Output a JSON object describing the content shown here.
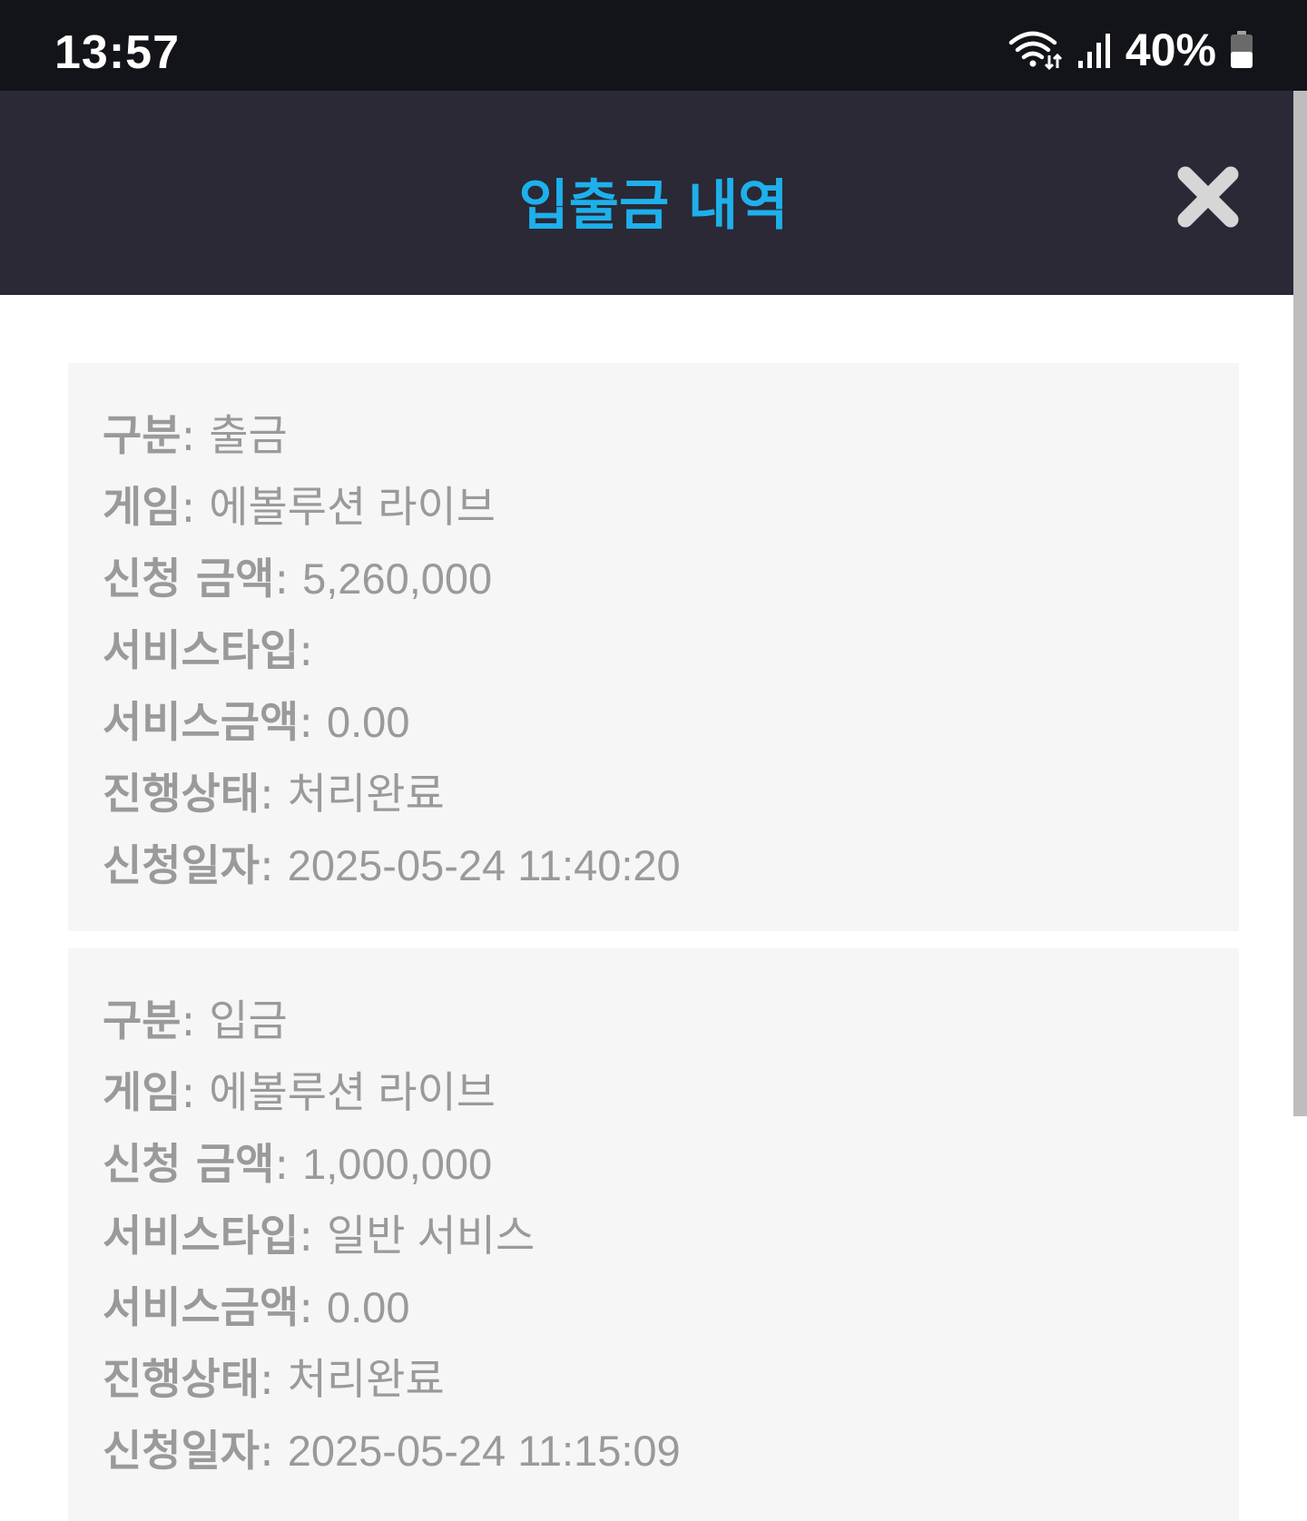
{
  "status_bar": {
    "time": "13:57",
    "battery": "40%"
  },
  "header": {
    "title": "입출금 내역"
  },
  "labels": {
    "type": "구분",
    "game": "게임",
    "amount": "신청 금액",
    "service_type": "서비스타입",
    "service_amount": "서비스금액",
    "status": "진행상태",
    "date": "신청일자"
  },
  "records": [
    {
      "type": "출금",
      "game": "에볼루션 라이브",
      "amount": "5,260,000",
      "service_type": "",
      "service_amount": "0.00",
      "status": "처리완료",
      "date": "2025-05-24 11:40:20"
    },
    {
      "type": "입금",
      "game": "에볼루션 라이브",
      "amount": "1,000,000",
      "service_type": "일반 서비스",
      "service_amount": "0.00",
      "status": "처리완료",
      "date": "2025-05-24 11:15:09"
    }
  ],
  "colors": {
    "status_bar_bg": "#131419",
    "header_bg": "#2a2935",
    "title_color": "#1eb0ec",
    "card_bg": "#f6f6f6",
    "text_color": "#9a9a9a"
  },
  "icons": {
    "close": "close-icon",
    "wifi": "wifi-icon",
    "signal": "signal-icon",
    "battery": "battery-icon"
  }
}
